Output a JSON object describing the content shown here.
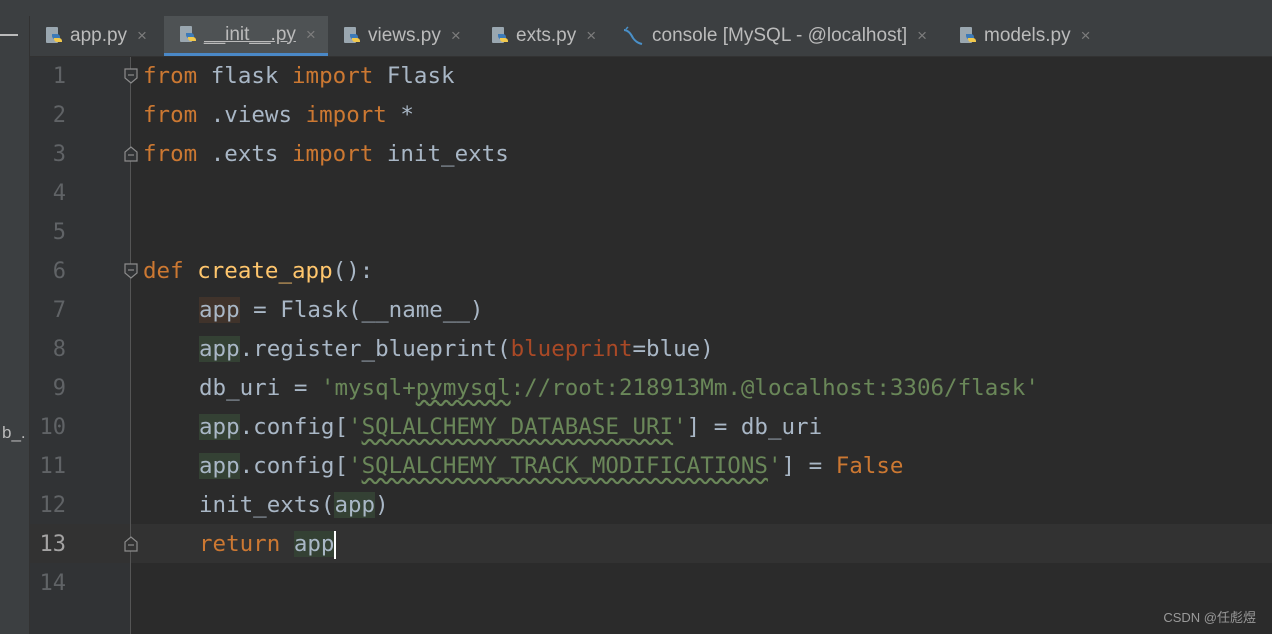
{
  "colors": {
    "background": "#2b2b2b",
    "keyword": "#cc7832",
    "function": "#ffc66d",
    "string": "#6a8759",
    "text": "#a9b7c6",
    "param": "#aa4926",
    "active_tab_underline": "#4a88c7"
  },
  "left_panel": {
    "cut_label": "b_."
  },
  "tabs": [
    {
      "label": "app.py",
      "icon": "python-file-icon",
      "active": false
    },
    {
      "label": "__init__.py",
      "icon": "python-file-icon",
      "active": true
    },
    {
      "label": "views.py",
      "icon": "python-file-icon",
      "active": false
    },
    {
      "label": "exts.py",
      "icon": "python-file-icon",
      "active": false
    },
    {
      "label": "console [MySQL - @localhost]",
      "icon": "mysql-console-icon",
      "active": false
    },
    {
      "label": "models.py",
      "icon": "python-file-icon",
      "active": false
    }
  ],
  "close_glyph": "×",
  "editor": {
    "current_line": 13,
    "line_numbers": [
      "1",
      "2",
      "3",
      "4",
      "5",
      "6",
      "7",
      "8",
      "9",
      "10",
      "11",
      "12",
      "13",
      "14"
    ],
    "code": {
      "l1": {
        "kw1": "from",
        "t1": " flask ",
        "kw2": "import",
        "t2": " Flask"
      },
      "l2": {
        "kw1": "from",
        "t1": " .views ",
        "kw2": "import",
        "t2": " *"
      },
      "l3": {
        "kw1": "from",
        "t1": " .exts ",
        "kw2": "import",
        "t2": " init_exts"
      },
      "l6": {
        "kw": "def",
        "sp": " ",
        "fn": "create_app",
        "t": "():"
      },
      "l7": {
        "var": "app",
        "t": " = Flask(__name__)"
      },
      "l8": {
        "var": "app",
        "t1": ".register_blueprint(",
        "param": "blueprint",
        "t2": "=blue)"
      },
      "l9": {
        "t": "db_uri = ",
        "q1": "'",
        "s1": "mysql+",
        "s2": "pymysql",
        "s3": "://root:218913Mm.@localhost:3306/flask",
        "q2": "'"
      },
      "l10": {
        "var": "app",
        "t1": ".config[",
        "q1": "'",
        "s": "SQLALCHEMY_DATABASE_URI",
        "q2": "'",
        "t2": "] = db_uri"
      },
      "l11": {
        "var": "app",
        "t1": ".config[",
        "q1": "'",
        "s": "SQLALCHEMY_TRACK_MODIFICATIONS",
        "q2": "'",
        "t2": "] = ",
        "kw": "False"
      },
      "l12": {
        "t1": "init_exts(",
        "var": "app",
        "t2": ")"
      },
      "l13": {
        "kw": "return",
        "sp": " ",
        "var": "app"
      }
    }
  },
  "watermark": "CSDN @任彪煜"
}
